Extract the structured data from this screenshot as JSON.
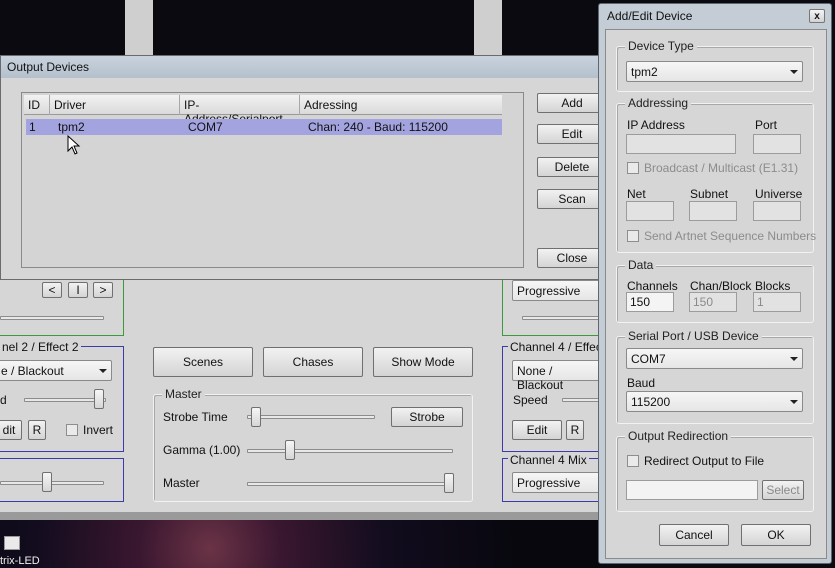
{
  "background_app": {
    "title_fragment": "trix-LED",
    "buttons": {
      "scenes": "Scenes",
      "chases": "Chases",
      "show_mode": "Show Mode",
      "strobe": "Strobe",
      "edit_left": "dit",
      "edit_right": "Edit"
    },
    "channel2": {
      "title": "nel 2 / Effect 2",
      "effect": "e / Blackout",
      "speed_fragment": "d",
      "reset": "R",
      "invert": "Invert"
    },
    "channel4": {
      "title": "Channel 4 / Effec",
      "effect": "None / Blackout",
      "speed": "Speed",
      "reset": "R"
    },
    "channel4_mix": {
      "title": "Channel 4 Mix",
      "value": "Progressive"
    },
    "channel3_mix_value": "Progressive",
    "nav": {
      "prev": "<",
      "mid": "I",
      "next": ">"
    },
    "master": {
      "title": "Master",
      "strobe_time": "Strobe Time",
      "gamma": "Gamma (1.00)",
      "master": "Master"
    }
  },
  "output_devices": {
    "title": "Output Devices",
    "columns": [
      "ID",
      "Driver",
      "IP-Address/Serialport",
      "Adressing"
    ],
    "rows": [
      {
        "id": "1",
        "driver": "tpm2",
        "port": "COM7",
        "addressing": "Chan: 240 - Baud: 115200"
      }
    ],
    "buttons": {
      "add": "Add",
      "edit": "Edit",
      "delete": "Delete",
      "scan": "Scan",
      "close": "Close"
    }
  },
  "add_edit_device": {
    "title": "Add/Edit Device",
    "close_glyph": "x",
    "device_type": {
      "group": "Device Type",
      "value": "tpm2"
    },
    "addressing": {
      "group": "Addressing",
      "ip_label": "IP Address",
      "port_label": "Port",
      "broadcast": "Broadcast / Multicast (E1.31)",
      "net_label": "Net",
      "subnet_label": "Subnet",
      "universe_label": "Universe",
      "artnet_seq": "Send Artnet Sequence Numbers"
    },
    "data": {
      "group": "Data",
      "channels_label": "Channels",
      "channels_value": "150",
      "chanblock_label": "Chan/Block",
      "chanblock_value": "150",
      "blocks_label": "Blocks",
      "blocks_value": "1"
    },
    "serial": {
      "group": "Serial Port / USB Device",
      "port_value": "COM7",
      "baud_label": "Baud",
      "baud_value": "115200"
    },
    "redirection": {
      "group": "Output Redirection",
      "redirect_label": "Redirect Output to File",
      "select": "Select"
    },
    "cancel": "Cancel",
    "ok": "OK"
  },
  "colors": {
    "selection": "#a3a3e0",
    "panel": "#d6d6d6",
    "group_border_blue": "#3c3ca8",
    "group_border_green": "#3b9b3b"
  }
}
